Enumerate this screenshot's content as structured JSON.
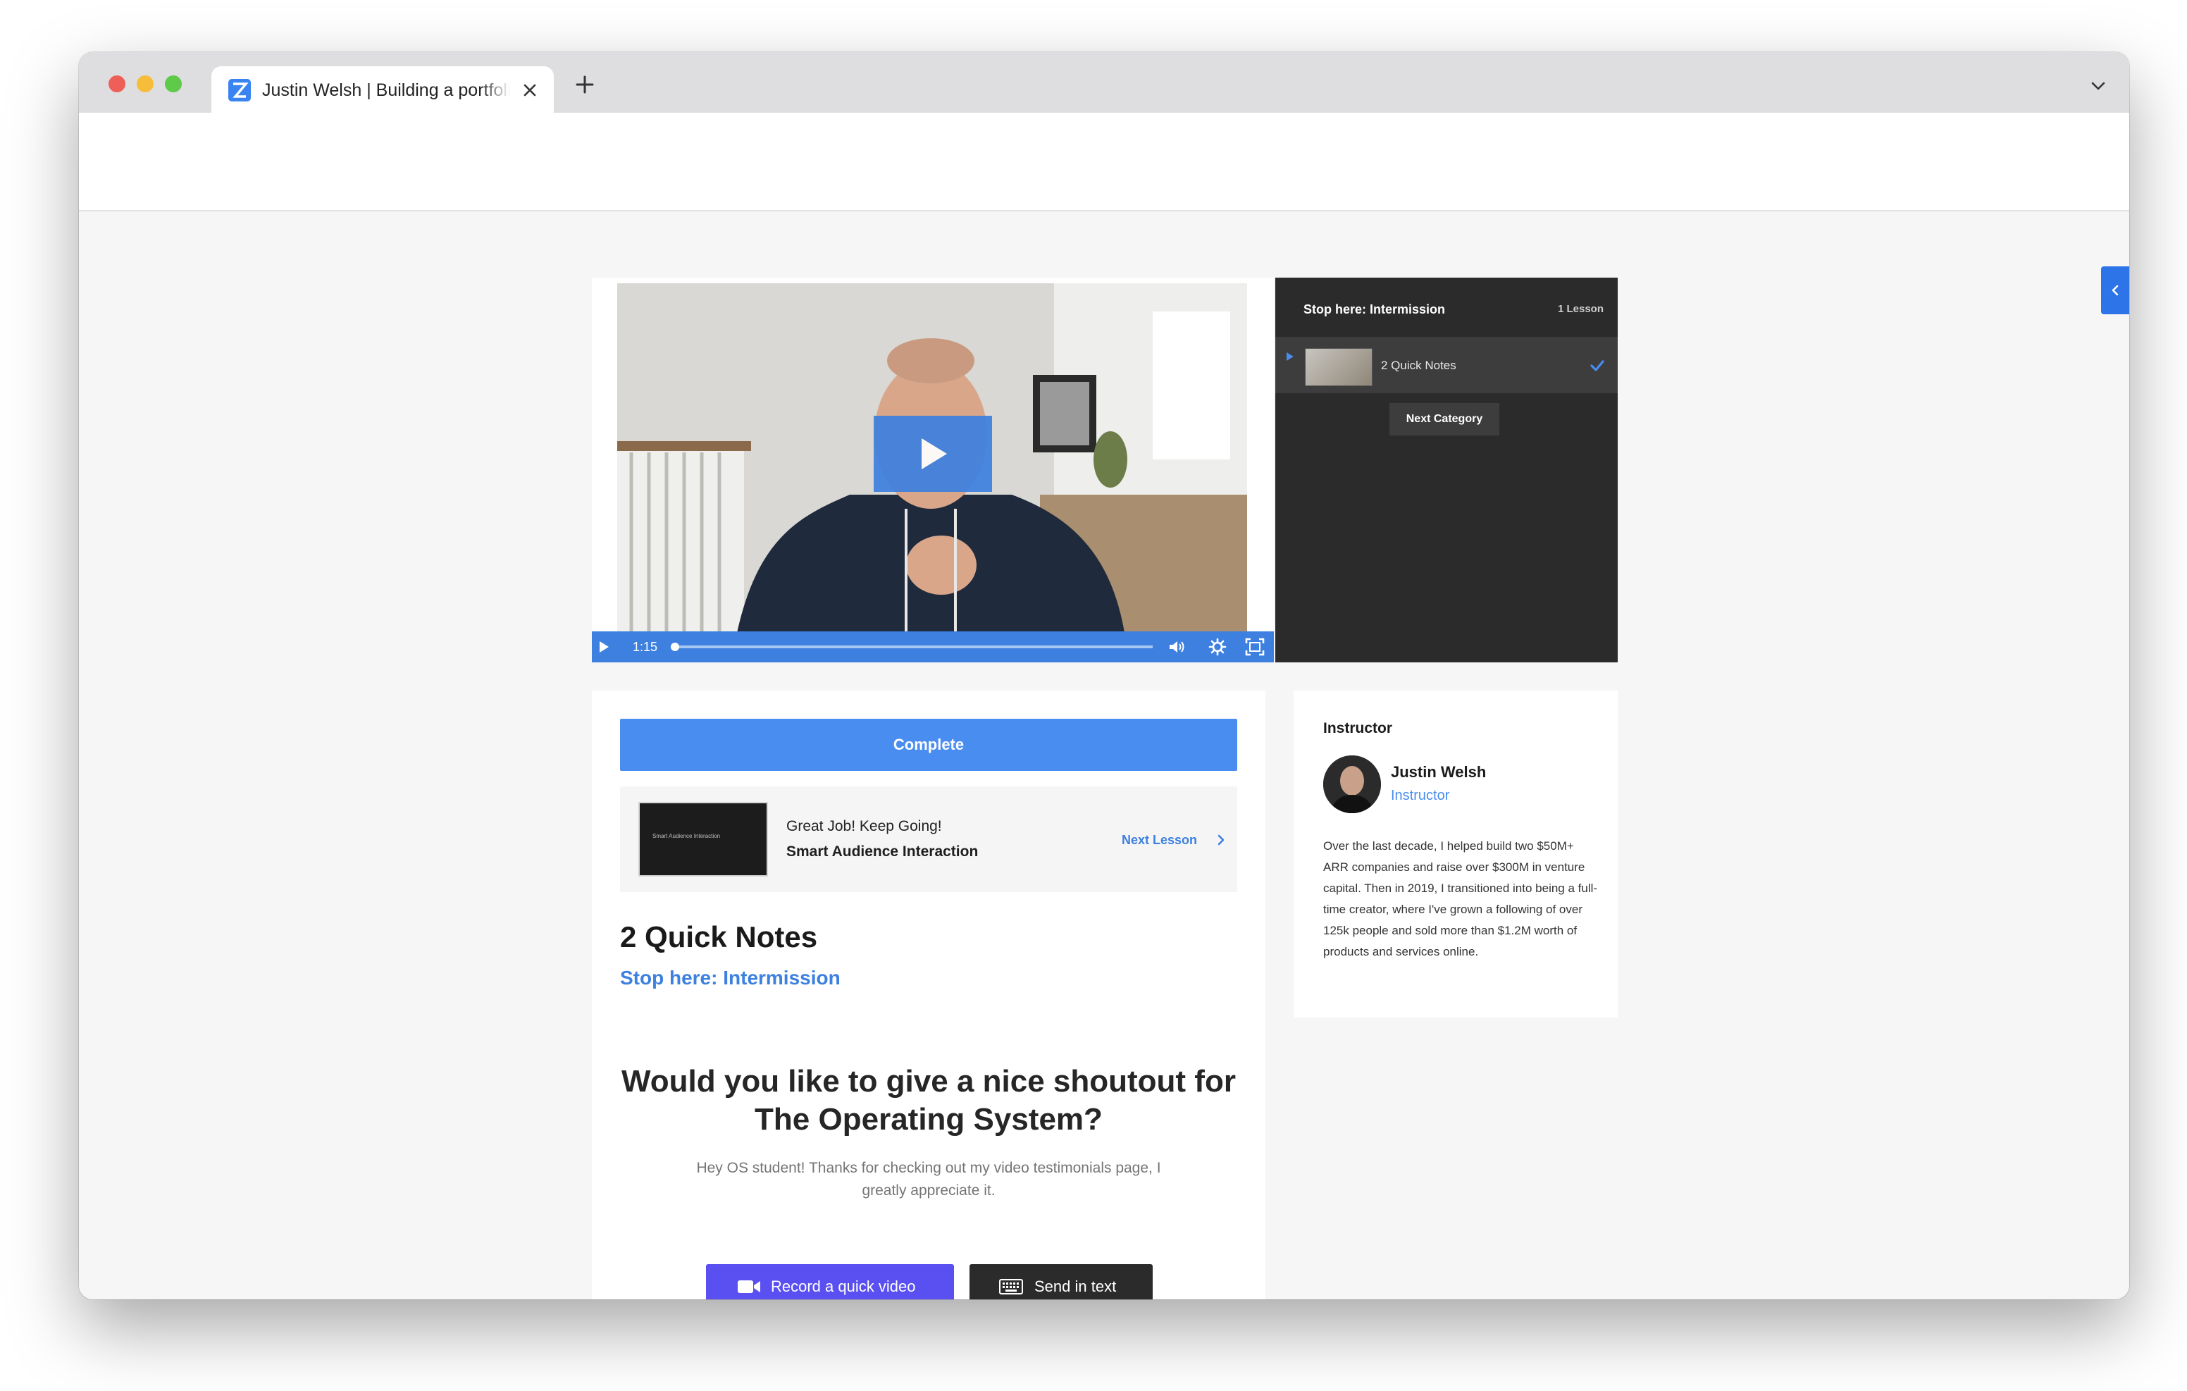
{
  "browser": {
    "tab_title": "Justin Welsh | Building a portfolio",
    "icons": {
      "close": "close-icon",
      "new_tab": "plus-icon",
      "dropdown": "chevron-down-icon"
    }
  },
  "player": {
    "time": "1:15",
    "progress": 0.0,
    "icons": [
      "play-icon",
      "volume-icon",
      "settings-icon",
      "fullscreen-icon"
    ]
  },
  "playlist": {
    "category_title": "Stop here: Intermission",
    "lesson_count": "1 Lesson",
    "items": [
      {
        "label": "2 Quick Notes",
        "completed": true
      }
    ],
    "next_category_label": "Next Category"
  },
  "lesson": {
    "complete_label": "Complete",
    "next_lesson": {
      "kicker": "Great Job! Keep Going!",
      "title": "Smart Audience Interaction",
      "thumb_text": "Smart Audience Interaction",
      "link_label": "Next Lesson"
    },
    "title": "2 Quick Notes",
    "category": "Stop here: Intermission"
  },
  "testimonial": {
    "heading": "Would you like to give a nice shoutout for The Operating System?",
    "subtext": "Hey OS student! Thanks for checking out my video testimonials page, I greatly appreciate it.",
    "record_label": "Record a quick video",
    "text_label": "Send in text",
    "record_color": "#5a4ff0"
  },
  "instructor": {
    "heading": "Instructor",
    "name": "Justin Welsh",
    "role": "Instructor",
    "bio": "Over the last decade, I helped build two $50M+ ARR companies and raise over $300M in venture capital. Then in 2019, I transitioned into being a full-time creator, where I've grown a following of over 125k people and sold more than $1.2M worth of products and services online."
  },
  "colors": {
    "accent": "#3d80e0",
    "complete_button": "#4a8df0",
    "playlist_bg": "#2b2b2b"
  }
}
